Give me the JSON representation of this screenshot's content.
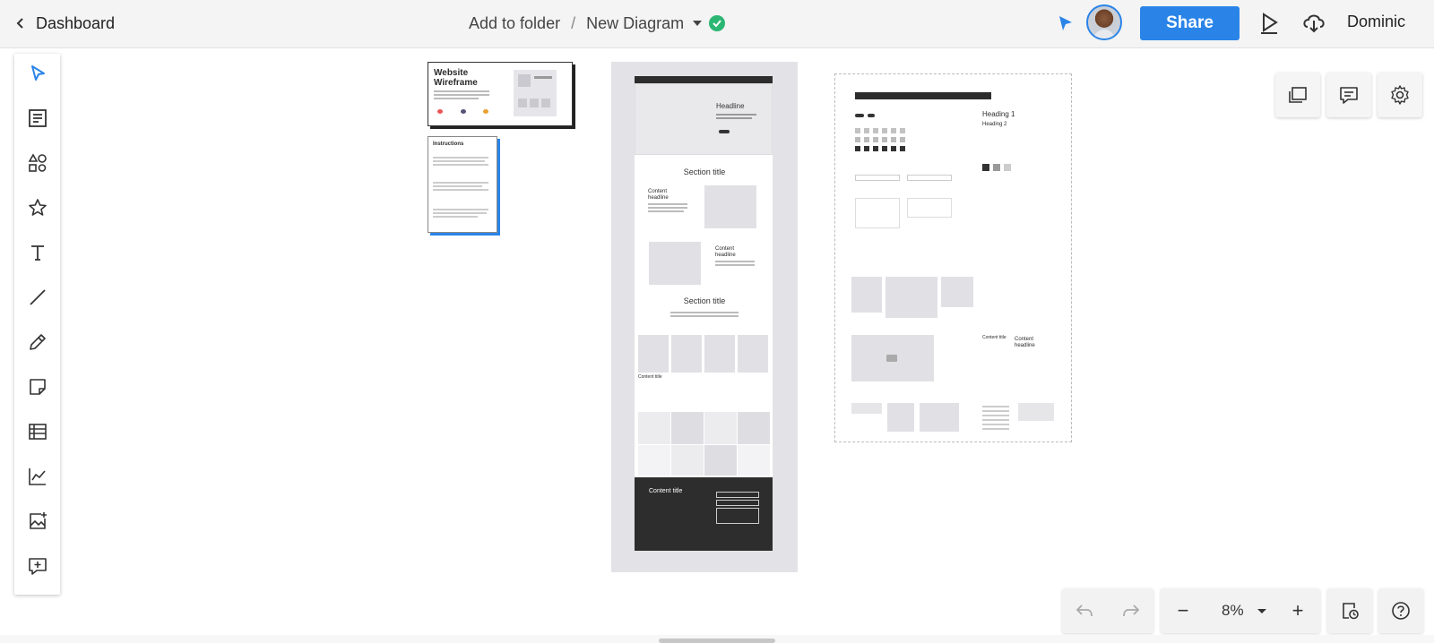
{
  "header": {
    "back_label": "Dashboard",
    "folder_label": "Add to folder",
    "separator": "/",
    "diagram_title": "New Diagram",
    "share_label": "Share",
    "user_name": "Dominic"
  },
  "colors": {
    "accent": "#2a84e8",
    "saved_status": "#2bb673",
    "toolbar_bg": "#f4f4f4"
  },
  "left_toolbar": [
    {
      "name": "select-tool",
      "icon": "cursor-icon"
    },
    {
      "name": "templates-tool",
      "icon": "template-icon"
    },
    {
      "name": "shapes-tool",
      "icon": "shapes-icon"
    },
    {
      "name": "icons-tool",
      "icon": "star-icon"
    },
    {
      "name": "text-tool",
      "icon": "text-icon"
    },
    {
      "name": "line-tool",
      "icon": "line-icon"
    },
    {
      "name": "pen-tool",
      "icon": "pencil-icon"
    },
    {
      "name": "sticky-note-tool",
      "icon": "sticky-note-icon"
    },
    {
      "name": "table-tool",
      "icon": "table-icon"
    },
    {
      "name": "chart-tool",
      "icon": "chart-icon"
    },
    {
      "name": "image-tool",
      "icon": "image-add-icon"
    },
    {
      "name": "comment-tool",
      "icon": "comment-add-icon"
    }
  ],
  "canvas": {
    "card_title": "Website Wireframe",
    "instructions_title": "Instructions",
    "page_headline": "Headline",
    "section_title_1": "Section title",
    "section_title_2": "Section title",
    "content_headline_1": "Content headline",
    "content_headline_2": "Content headline",
    "content_title": "Content title",
    "footer_content_title": "Content title",
    "kit_heading_1": "Heading 1",
    "kit_heading_2": "Heading 2",
    "kit_content_title": "Content title",
    "kit_content_headline": "Content headline"
  },
  "zoom": {
    "value": "8%",
    "minus": "−",
    "plus": "+"
  }
}
